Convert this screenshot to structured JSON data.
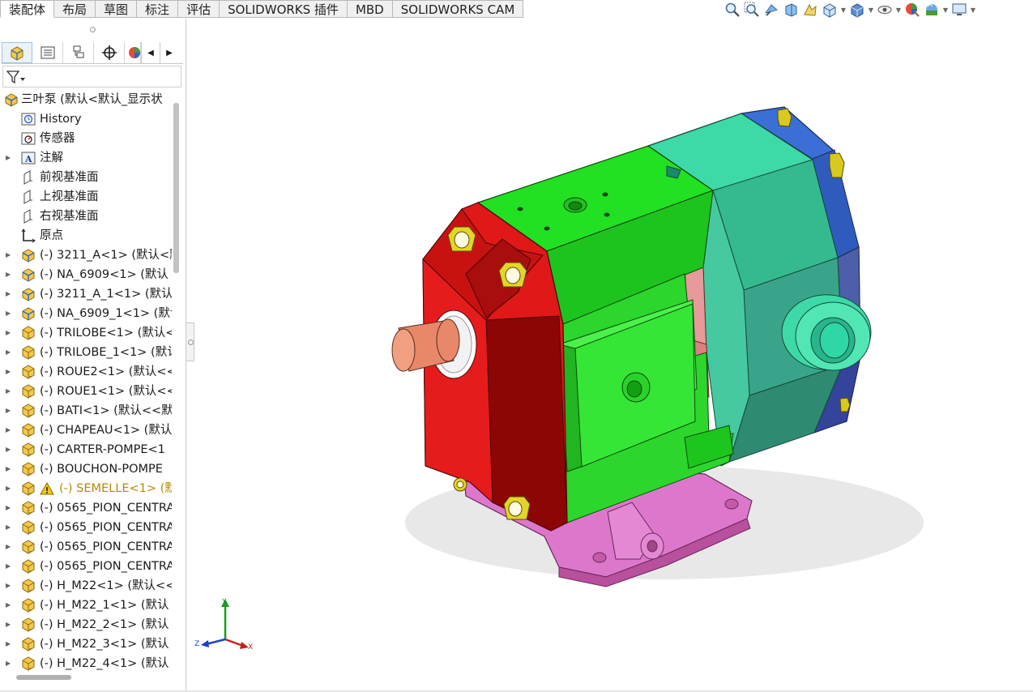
{
  "tabs": [
    "装配体",
    "布局",
    "草图",
    "标注",
    "评估",
    "SOLIDWORKS 插件",
    "MBD",
    "SOLIDWORKS CAM"
  ],
  "active_tab_index": 0,
  "hud_icons": [
    "zoom-to-fit-icon",
    "zoom-area-icon",
    "previous-view-icon",
    "section-view-icon",
    "dynamic-annotation-icon",
    "view-orientation-icon",
    "display-style-icon",
    "hide-show-icon",
    "edit-appearance-icon",
    "apply-scene-icon",
    "view-settings-icon"
  ],
  "panel_tabs": [
    "featuremanager-icon",
    "propertymanager-icon",
    "configurationmanager-icon",
    "dimxpert-icon",
    "display-manager-icon"
  ],
  "tree": {
    "root": "三叶泵  (默认<默认_显示状",
    "items": [
      {
        "label": "History",
        "icon": "history-icon",
        "expand": false
      },
      {
        "label": "传感器",
        "icon": "sensor-icon",
        "expand": false
      },
      {
        "label": "注解",
        "icon": "annotation-icon",
        "expand": true
      },
      {
        "label": "前视基准面",
        "icon": "plane-icon",
        "expand": false
      },
      {
        "label": "上视基准面",
        "icon": "plane-icon",
        "expand": false
      },
      {
        "label": "右视基准面",
        "icon": "plane-icon",
        "expand": false
      },
      {
        "label": "原点",
        "icon": "origin-icon",
        "expand": false
      },
      {
        "label": "(-) 3211_A<1> (默认<默",
        "icon": "subassembly-icon",
        "expand": true
      },
      {
        "label": "(-) NA_6909<1> (默认",
        "icon": "subassembly-icon",
        "expand": true
      },
      {
        "label": "(-) 3211_A_1<1> (默认",
        "icon": "subassembly-icon",
        "expand": true
      },
      {
        "label": "(-) NA_6909_1<1> (默认",
        "icon": "subassembly-icon",
        "expand": true
      },
      {
        "label": "(-) TRILOBE<1> (默认<",
        "icon": "part-icon",
        "expand": true
      },
      {
        "label": "(-) TRILOBE_1<1> (默认",
        "icon": "part-icon",
        "expand": true
      },
      {
        "label": "(-) ROUE2<1> (默认<<",
        "icon": "part-icon",
        "expand": true
      },
      {
        "label": "(-) ROUE1<1> (默认<<",
        "icon": "part-icon",
        "expand": true
      },
      {
        "label": "(-) BATI<1> (默认<<默",
        "icon": "part-icon",
        "expand": true
      },
      {
        "label": "(-) CHAPEAU<1> (默认",
        "icon": "part-icon",
        "expand": true
      },
      {
        "label": "(-) CARTER-POMPE<1",
        "icon": "part-icon",
        "expand": true
      },
      {
        "label": "(-) BOUCHON-POMPE",
        "icon": "part-icon",
        "expand": true
      },
      {
        "label": "(-) SEMELLE<1> (默",
        "icon": "part-icon",
        "expand": true,
        "warning": true
      },
      {
        "label": "(-) 0565_PION_CENTRA",
        "icon": "part-icon",
        "expand": true
      },
      {
        "label": "(-) 0565_PION_CENTRA",
        "icon": "part-icon",
        "expand": true
      },
      {
        "label": "(-) 0565_PION_CENTRA",
        "icon": "part-icon",
        "expand": true
      },
      {
        "label": "(-) 0565_PION_CENTRA",
        "icon": "part-icon",
        "expand": true
      },
      {
        "label": "(-) H_M22<1> (默认<<",
        "icon": "part-icon",
        "expand": true
      },
      {
        "label": "(-) H_M22_1<1> (默认",
        "icon": "part-icon",
        "expand": true
      },
      {
        "label": "(-) H_M22_2<1> (默认",
        "icon": "part-icon",
        "expand": true
      },
      {
        "label": "(-) H_M22_3<1> (默认",
        "icon": "part-icon",
        "expand": true
      },
      {
        "label": "(-) H_M22_4<1> (默认",
        "icon": "part-icon",
        "expand": true
      }
    ]
  },
  "triad": {
    "x": "X",
    "y": "Y",
    "z": "Z"
  },
  "colors": {
    "tab_bg": "#f0f0f0",
    "housing_red": "#e01818",
    "body_green": "#22e022",
    "teal": "#3ed9a8",
    "blue_cover": "#3b6fd6",
    "base_pink": "#dd77cc",
    "bolt_yellow": "#e3d42a",
    "shaft": "#e8876a"
  }
}
